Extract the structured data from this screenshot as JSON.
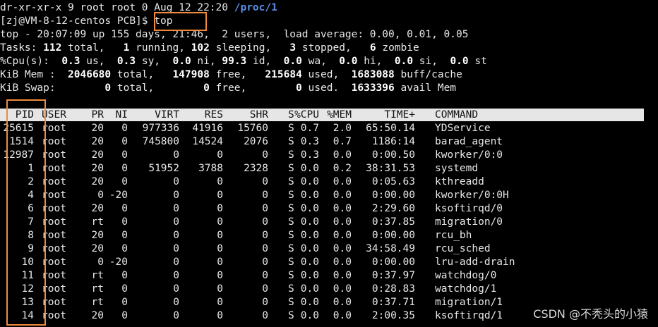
{
  "terminal": {
    "top_line": {
      "text": "dr-xr-xr-x 9 root root 0 Aug 12 22:20 ",
      "path": "/proc/1"
    },
    "prompt": {
      "text": "[zj@VM-8-12-centos PCB]$ ",
      "command": "top"
    },
    "uptime": "top - 20:07:09 up 155 days, 21:46,  2 users,  load average: 0.00, 0.01, 0.05",
    "tasks": {
      "label": "Tasks: ",
      "total": "112",
      "total_l": " total,   ",
      "running": "1",
      "running_l": " running, ",
      "sleeping": "102",
      "sleeping_l": " sleeping,   ",
      "stopped": "3",
      "stopped_l": " stopped,   ",
      "zombie": "6",
      "zombie_l": " zombie"
    },
    "cpu": {
      "label": "%Cpu(s):  ",
      "us": "0.3",
      "us_l": " us,  ",
      "sy": "0.3",
      "sy_l": " sy,  ",
      "ni": "0.0",
      "ni_l": " ni, ",
      "id": "99.3",
      "id_l": " id,  ",
      "wa": "0.0",
      "wa_l": " wa,  ",
      "hi": "0.0",
      "hi_l": " hi,  ",
      "si": "0.0",
      "si_l": " si,  ",
      "st": "0.0",
      "st_l": " st"
    },
    "mem": {
      "label": "KiB Mem :  ",
      "total": "2046680",
      "total_l": " total,   ",
      "free": "147908",
      "free_l": " free,   ",
      "used": "215684",
      "used_l": " used,  ",
      "cache": "1683088",
      "cache_l": " buff/cache"
    },
    "swap": {
      "label": "KiB Swap:        ",
      "total": "0",
      "total_l": " total,        ",
      "free": "0",
      "free_l": " free,        ",
      "used": "0",
      "used_l": " used.  ",
      "avail": "1633396",
      "avail_l": " avail Mem"
    }
  },
  "table": {
    "headers": [
      "PID",
      "USER",
      "PR",
      "NI",
      "VIRT",
      "RES",
      "SHR",
      "S",
      "%CPU",
      "%MEM",
      "TIME+",
      "COMMAND"
    ],
    "rows": [
      [
        "25615",
        "root",
        "20",
        "0",
        "977336",
        "41916",
        "15760",
        "S",
        "0.7",
        "2.0",
        "65:50.14",
        "YDService"
      ],
      [
        "1514",
        "root",
        "20",
        "0",
        "745800",
        "14524",
        "2076",
        "S",
        "0.3",
        "0.7",
        "1186:14",
        "barad_agent"
      ],
      [
        "12987",
        "root",
        "20",
        "0",
        "0",
        "0",
        "0",
        "S",
        "0.3",
        "0.0",
        "0:00.50",
        "kworker/0:0"
      ],
      [
        "1",
        "root",
        "20",
        "0",
        "51952",
        "3788",
        "2328",
        "S",
        "0.0",
        "0.2",
        "38:31.53",
        "systemd"
      ],
      [
        "2",
        "root",
        "20",
        "0",
        "0",
        "0",
        "0",
        "S",
        "0.0",
        "0.0",
        "0:05.63",
        "kthreadd"
      ],
      [
        "4",
        "root",
        "0",
        "-20",
        "0",
        "0",
        "0",
        "S",
        "0.0",
        "0.0",
        "0:00.00",
        "kworker/0:0H"
      ],
      [
        "6",
        "root",
        "20",
        "0",
        "0",
        "0",
        "0",
        "S",
        "0.0",
        "0.0",
        "2:29.60",
        "ksoftirqd/0"
      ],
      [
        "7",
        "root",
        "rt",
        "0",
        "0",
        "0",
        "0",
        "S",
        "0.0",
        "0.0",
        "0:37.85",
        "migration/0"
      ],
      [
        "8",
        "root",
        "20",
        "0",
        "0",
        "0",
        "0",
        "S",
        "0.0",
        "0.0",
        "0:00.00",
        "rcu_bh"
      ],
      [
        "9",
        "root",
        "20",
        "0",
        "0",
        "0",
        "0",
        "S",
        "0.0",
        "0.0",
        "34:58.49",
        "rcu_sched"
      ],
      [
        "10",
        "root",
        "0",
        "-20",
        "0",
        "0",
        "0",
        "S",
        "0.0",
        "0.0",
        "0:00.00",
        "lru-add-drain"
      ],
      [
        "11",
        "root",
        "rt",
        "0",
        "0",
        "0",
        "0",
        "S",
        "0.0",
        "0.0",
        "0:37.97",
        "watchdog/0"
      ],
      [
        "12",
        "root",
        "rt",
        "0",
        "0",
        "0",
        "0",
        "S",
        "0.0",
        "0.0",
        "0:28.83",
        "watchdog/1"
      ],
      [
        "13",
        "root",
        "rt",
        "0",
        "0",
        "0",
        "0",
        "S",
        "0.0",
        "0.0",
        "0:37.71",
        "migration/1"
      ],
      [
        "14",
        "root",
        "20",
        "0",
        "0",
        "0",
        "0",
        "S",
        "0.0",
        "0.0",
        "2:00.35",
        "ksoftirqd/1"
      ]
    ]
  },
  "watermark": "CSDN @不秃头的小猿",
  "colors": {
    "highlight": "#f08a3c",
    "path": "#5b8ee6",
    "header_bg": "#e6e6e6",
    "background": "#000000"
  }
}
